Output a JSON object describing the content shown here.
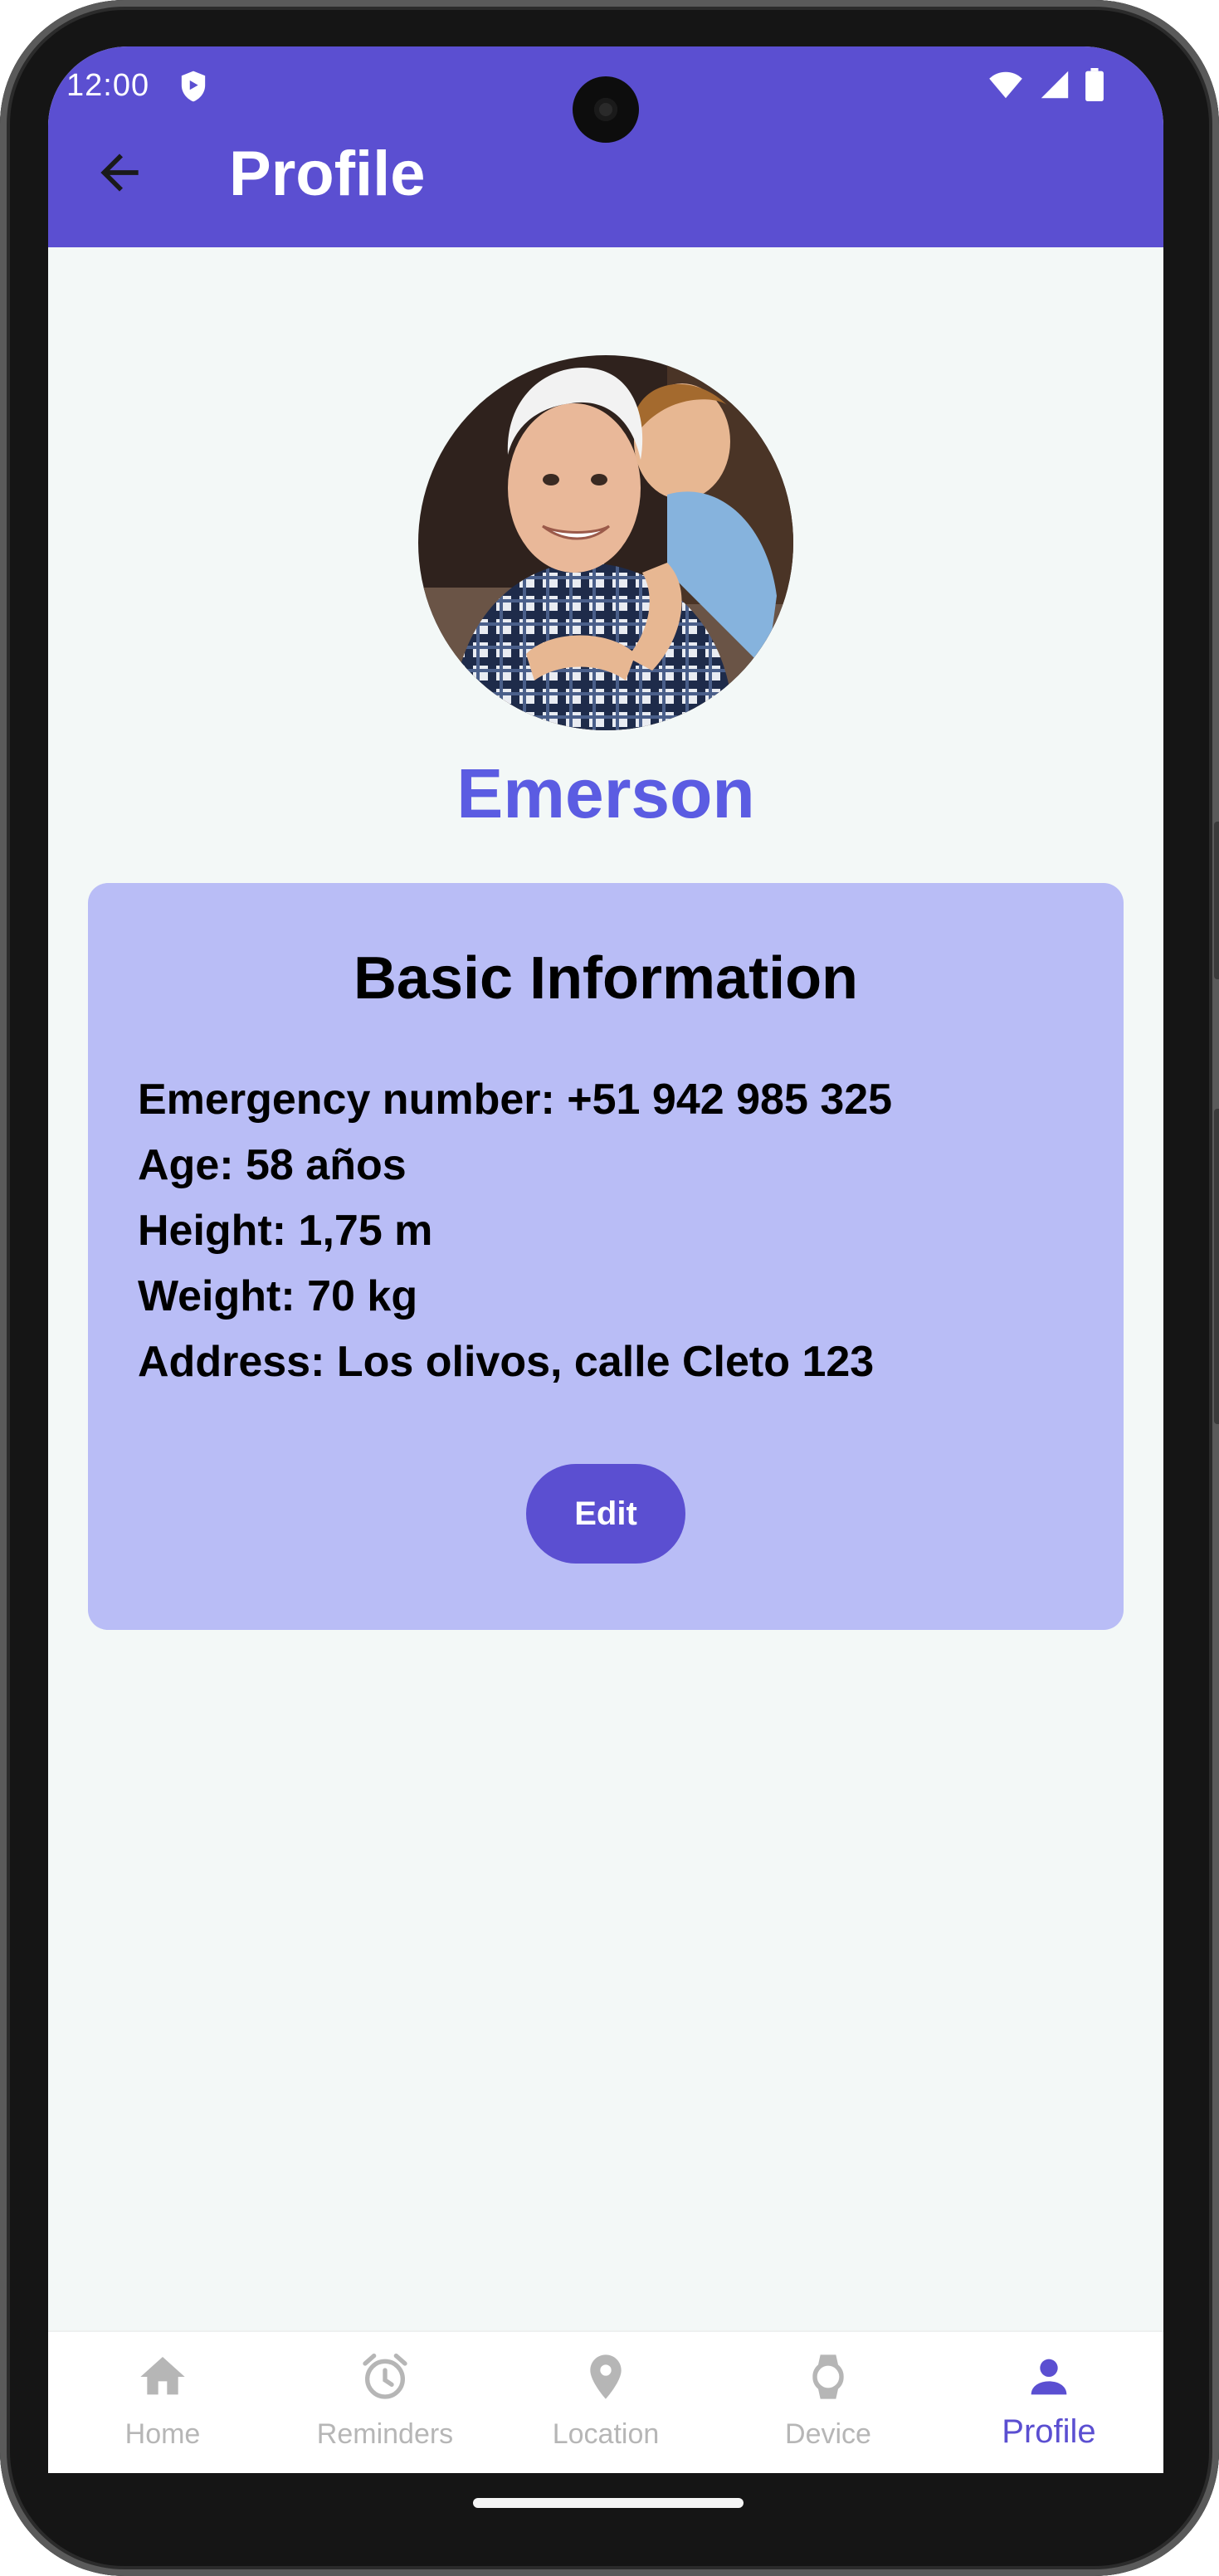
{
  "status_bar": {
    "time": "12:00"
  },
  "app_bar": {
    "title": "Profile"
  },
  "profile": {
    "name": "Emerson"
  },
  "card": {
    "title": "Basic Information",
    "lines": [
      "Emergency number: +51 942 985 325",
      "Age: 58 años",
      "Height: 1,75 m",
      "Weight: 70 kg",
      "Address: Los olivos, calle Cleto 123"
    ],
    "edit_label": "Edit"
  },
  "bottom_nav": {
    "items": [
      {
        "label": "Home",
        "icon": "home-icon"
      },
      {
        "label": "Reminders",
        "icon": "alarm-icon"
      },
      {
        "label": "Location",
        "icon": "location-pin-icon"
      },
      {
        "label": "Device",
        "icon": "watch-icon"
      },
      {
        "label": "Profile",
        "icon": "person-icon"
      }
    ],
    "active": "Profile"
  },
  "colors": {
    "primary": "#5b4fd1",
    "name_accent": "#5b5ce2",
    "card_bg": "#b9bdf6",
    "screen_bg": "#f3f8f7",
    "nav_inactive": "#b6b6b6"
  }
}
